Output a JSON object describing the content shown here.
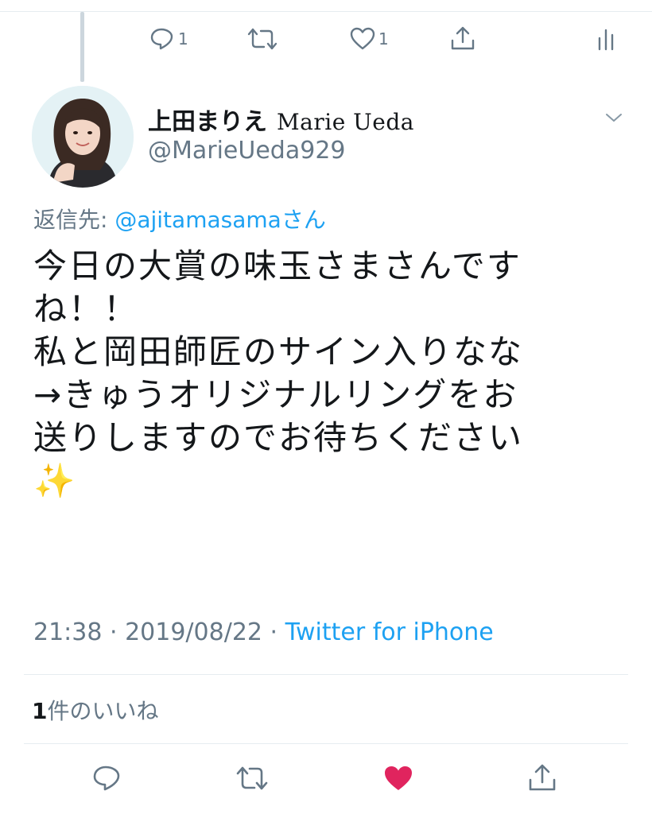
{
  "top_actions": {
    "reply_count": "1",
    "like_count": "1"
  },
  "author": {
    "display_name_jp": "上田まりえ",
    "display_name_en": "Marie Ueda",
    "handle": "@MarieUeda929"
  },
  "reply_to": {
    "prefix": "返信先: ",
    "mention": "@ajitamasama",
    "suffix": "さん"
  },
  "tweet": {
    "text": "今日の大賞の味玉さまさんです\nね！！\n私と岡田師匠のサイン入りなな\n→きゅうオリジナルリングをお\n送りしますのでお待ちください\n✨"
  },
  "meta": {
    "time": "21:38",
    "separator": " · ",
    "date": "2019/08/22",
    "source": "Twitter for iPhone"
  },
  "likes": {
    "count": "1",
    "label": "件のいいね"
  },
  "colors": {
    "accent": "#1da1f2",
    "muted": "#657786",
    "liked": "#e0245e",
    "divider": "#e6ecf0"
  }
}
